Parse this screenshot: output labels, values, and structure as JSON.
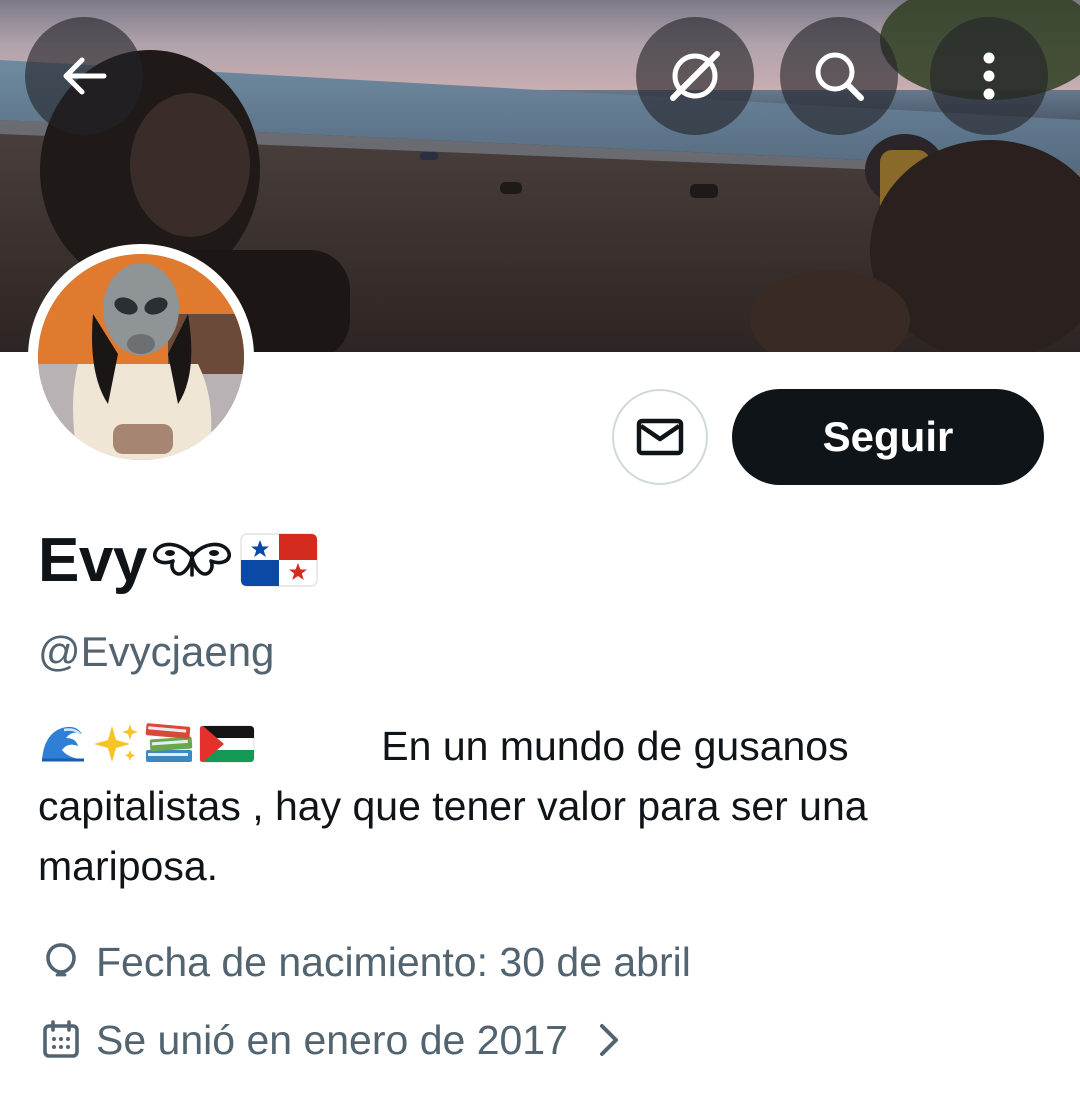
{
  "profile": {
    "display_name": "Evy",
    "handle": "@Evycjaeng",
    "bio_line1": "           En un mundo de gusanos",
    "bio_rest": "capitalistas , hay que tener valor para ser una mariposa.",
    "birthday": "Fecha de nacimiento: 30 de abril",
    "joined": "Se unió en enero de 2017"
  },
  "actions": {
    "follow_label": "Seguir"
  },
  "icons": {
    "back": "arrow-left-icon",
    "grok": "grok-icon",
    "search": "search-icon",
    "more": "more-vertical-icon",
    "message": "envelope-icon",
    "birthday": "balloon-icon",
    "joined": "calendar-icon",
    "joined_more": "chevron-right-icon",
    "name_emojis": [
      "butterfly-glyph",
      "panama-flag"
    ],
    "bio_emojis": [
      "water-wave-emoji",
      "sparkles-emoji",
      "books-emoji",
      "palestine-flag-emoji"
    ]
  },
  "colors": {
    "primary_text": "#0f1419",
    "secondary_text": "#536471",
    "button_dark": "#0f1419",
    "border": "#cfd9de"
  }
}
